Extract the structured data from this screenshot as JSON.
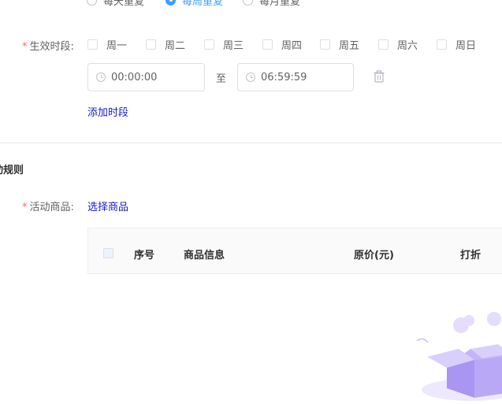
{
  "repeat_options": [
    {
      "label": "每天重复",
      "checked": false
    },
    {
      "label": "每周重复",
      "checked": true
    },
    {
      "label": "每月重复",
      "checked": false
    }
  ],
  "effective_period": {
    "label": "生效时段:",
    "required_mark": "*",
    "days": [
      "周一",
      "周二",
      "周三",
      "周四",
      "周五",
      "周六",
      "周日"
    ],
    "start_time": "00:00:00",
    "separator": "至",
    "end_time": "06:59:59",
    "add_period_link": "添加时段"
  },
  "section": {
    "title": "动规则"
  },
  "activity_goods": {
    "label": "活动商品:",
    "required_mark": "*",
    "select_link": "选择商品"
  },
  "table": {
    "headers": [
      "序号",
      "商品信息",
      "原价(元)",
      "打折"
    ]
  },
  "icons": {
    "clock": "clock-icon",
    "trash": "trash-icon",
    "empty_box": "empty-box-icon"
  },
  "colors": {
    "primary": "#409eff",
    "link": "#1a1acf",
    "required": "#f56c6c",
    "illustration": "#b9a8f5"
  }
}
